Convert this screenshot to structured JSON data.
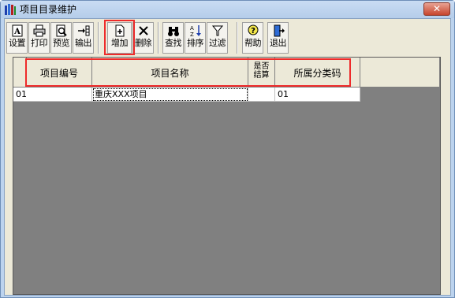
{
  "window": {
    "title": "项目目录维护",
    "close_label": "✕"
  },
  "toolbar": {
    "buttons": [
      {
        "label": "设置"
      },
      {
        "label": "打印"
      },
      {
        "label": "预览"
      },
      {
        "label": "输出"
      },
      {
        "label": "增加"
      },
      {
        "label": "删除"
      },
      {
        "label": "查找"
      },
      {
        "label": "排序"
      },
      {
        "label": "过滤"
      },
      {
        "label": "帮助"
      },
      {
        "label": "退出"
      }
    ]
  },
  "grid": {
    "columns": [
      "项目编号",
      "项目名称",
      "是否结算",
      "所属分类码"
    ],
    "column_short": {
      "settle_line1": "是否",
      "settle_line2": "结算"
    },
    "rows": [
      {
        "code": "01",
        "name": "重庆XXX项目",
        "settled": "",
        "category": "01"
      }
    ]
  },
  "colors": {
    "highlight": "#ee2b2b",
    "grid_background": "#808080",
    "toolbar": "#ece9d8"
  }
}
